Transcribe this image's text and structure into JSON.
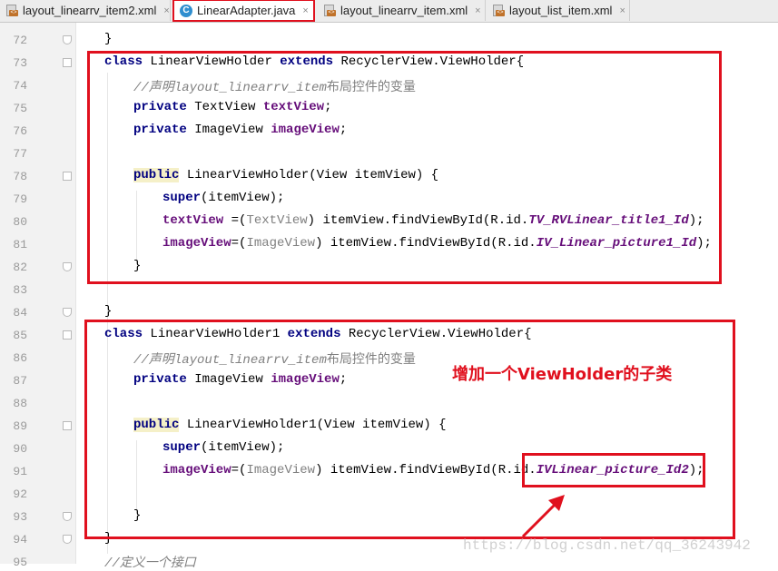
{
  "tabs": [
    {
      "label": "layout_linearrv_item2.xml",
      "icon": "xml-file-icon",
      "active": false
    },
    {
      "label": "LinearAdapter.java",
      "icon": "java-class-icon",
      "active": true
    },
    {
      "label": "layout_linearrv_item.xml",
      "icon": "xml-file-icon",
      "active": false
    },
    {
      "label": "layout_list_item.xml",
      "icon": "xml-file-icon",
      "active": false
    }
  ],
  "close_glyph": "×",
  "line_numbers": [
    "72",
    "73",
    "74",
    "75",
    "76",
    "77",
    "78",
    "79",
    "80",
    "81",
    "82",
    "83",
    "84",
    "85",
    "86",
    "87",
    "88",
    "89",
    "90",
    "91",
    "92",
    "93",
    "94",
    "95"
  ],
  "code": {
    "l72_brace": "}",
    "l73_class": "class",
    "l73_name": "LinearViewHolder",
    "l73_extends": "extends",
    "l73_super": "RecyclerView.ViewHolder{",
    "l74_comment_a": "//声明",
    "l74_comment_b": "layout_linearrv_item",
    "l74_comment_c": "布局控件的变量",
    "l75_private": "private",
    "l75_type": "TextView",
    "l75_field": "textView",
    "l75_semi": ";",
    "l76_private": "private",
    "l76_type": "ImageView",
    "l76_field": "imageView",
    "l76_semi": ";",
    "l78_public": "public",
    "l78_rest": "LinearViewHolder(View itemView) {",
    "l79_super": "super",
    "l79_rest": "(itemView);",
    "l80_field": "textView",
    "l80_eq": " =(",
    "l80_cast": "TextView",
    "l80_call": ") itemView.findViewById(R.id.",
    "l80_id": "TV_RVLinear_title1_Id",
    "l80_end": ");",
    "l81_field": "imageView",
    "l81_eq": "=(",
    "l81_cast": "ImageView",
    "l81_call": ") itemView.findViewById(R.id.",
    "l81_id": "IV_Linear_picture1_Id",
    "l81_end": ");",
    "l82_brace": "}",
    "l84_brace": "}",
    "l85_class": "class",
    "l85_name": "LinearViewHolder1",
    "l85_extends": "extends",
    "l85_super": "RecyclerView.ViewHolder{",
    "l86_comment_a": "//声明",
    "l86_comment_b": "layout_linearrv_item",
    "l86_comment_c": "布局控件的变量",
    "l87_private": "private",
    "l87_type": "ImageView",
    "l87_field": "imageView",
    "l87_semi": ";",
    "l89_public": "public",
    "l89_rest": "LinearViewHolder1(View itemView) {",
    "l90_super": "super",
    "l90_rest": "(itemView);",
    "l91_field": "imageView",
    "l91_eq": "=(",
    "l91_cast": "ImageView",
    "l91_call": ") itemView.findViewById(R.id.",
    "l91_id": "IVLinear_picture_Id2",
    "l91_end": ");",
    "l93_brace": "}",
    "l94_brace": "}",
    "l95_comment": "//定义一个接口"
  },
  "annotation": "增加一个ViewHolder的子类",
  "watermark": "https://blog.csdn.net/qq_36243942",
  "colors": {
    "accent_red": "#e0101e",
    "keyword": "#000080",
    "field": "#660e7a",
    "comment": "#808080"
  }
}
